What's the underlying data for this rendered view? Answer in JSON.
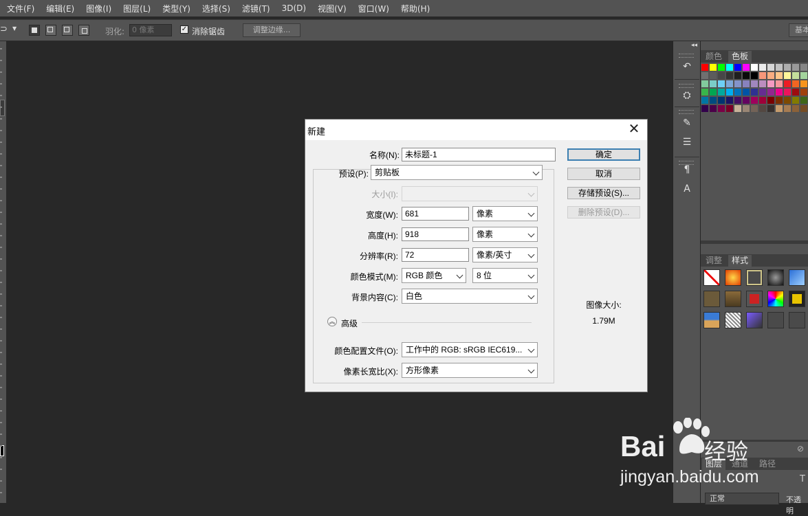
{
  "menubar": {
    "items": [
      "文件(F)",
      "编辑(E)",
      "图像(I)",
      "图层(L)",
      "类型(Y)",
      "选择(S)",
      "滤镜(T)",
      "3D(D)",
      "视图(V)",
      "窗口(W)",
      "帮助(H)"
    ]
  },
  "options": {
    "feather_label": "羽化:",
    "feather_value": "0 像素",
    "antialias_label": "消除锯齿",
    "refine_edge_label": "调整边缘...",
    "workspace_label": "基本"
  },
  "color_panel": {
    "tabs": [
      "颜色",
      "色板"
    ]
  },
  "styles_panel": {
    "tabs": [
      "调整",
      "样式"
    ]
  },
  "layers_panel": {
    "tabs": [
      "图层",
      "通道",
      "路径"
    ],
    "blend_mode": "正常",
    "opacity_label": "不透明"
  },
  "dialog": {
    "title": "新建",
    "name_label": "名称(N):",
    "name_value": "未标题-1",
    "preset_label": "预设(P):",
    "preset_value": "剪贴板",
    "size_label": "大小(I):",
    "width_label": "宽度(W):",
    "width_value": "681",
    "width_unit": "像素",
    "height_label": "高度(H):",
    "height_value": "918",
    "height_unit": "像素",
    "resolution_label": "分辨率(R):",
    "resolution_value": "72",
    "resolution_unit": "像素/英寸",
    "color_mode_label": "颜色模式(M):",
    "color_mode_value": "RGB 颜色",
    "bit_depth_value": "8 位",
    "background_label": "背景内容(C):",
    "background_value": "白色",
    "advanced_label": "高级",
    "profile_label": "颜色配置文件(O):",
    "profile_value": "工作中的 RGB: sRGB IEC619...",
    "aspect_label": "像素长宽比(X):",
    "aspect_value": "方形像素",
    "ok_label": "确定",
    "cancel_label": "取消",
    "save_preset_label": "存储预设(S)...",
    "delete_preset_label": "删除预设(D)...",
    "image_size_label": "图像大小:",
    "image_size_value": "1.79M"
  },
  "watermark": {
    "brand": "Bai",
    "brand_suffix": "经验",
    "url": "jingyan.baidu.com"
  }
}
